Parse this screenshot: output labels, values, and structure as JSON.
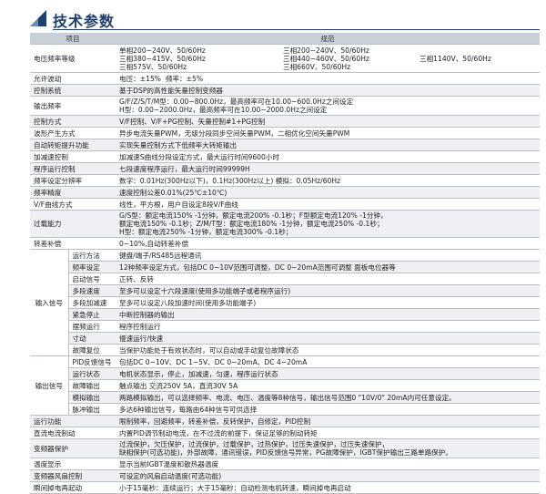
{
  "header": {
    "title": "技术参数"
  },
  "table": {
    "col_item": "项目",
    "col_spec": "规范",
    "voltage_label": "电压频率等级",
    "voltage_col1": [
      "单相200~240V、50/60Hz",
      "三相380~415V、50/60Hz",
      "三相575V、50/60Hz"
    ],
    "voltage_col2": [
      "三相200~240V、50/60Hz",
      "三相440~460V、50/60Hz",
      "三相660V、50/60Hz"
    ],
    "voltage_col3": "三相1140V、50/60Hz",
    "rows_a": [
      {
        "item": "允许波动",
        "spec": "电压：±15%  频率：±5%"
      },
      {
        "item": "控制系统",
        "spec": "基于DSP的高性能矢量控制变频器"
      },
      {
        "item": "输出频率",
        "spec": "G/F/Z/S/T/M型：0.00~800.0Hz，最高频率可在10.00~600.0Hz之间设定\nH型：0.00~2000.0Hz，最高频率可在10.00~2000.0Hz之间设定"
      },
      {
        "item": "控制方式",
        "spec": "V/F控制、V/F+PG控制、矢量控制#1+PG控制"
      },
      {
        "item": "波形产生方式",
        "spec": "异步电流矢量PWM，无级分段同步空间矢量PWM，二相优化空间矢量PWM"
      },
      {
        "item": "自动转矩提升功能",
        "spec": "实现矢量控制方式下低频率大转矩输出"
      },
      {
        "item": "加减速控制",
        "spec": "加减速S曲线分段设定方式，最大运行时间9600小时"
      },
      {
        "item": "程序运行控制",
        "spec": "七段速度程序运行，最大运行时间99999H"
      },
      {
        "item": "频率设定分辨率",
        "spec": "数字：0.01Hz(300Hz以下)，0.1Hz(300Hz以上) 模拟：0.05Hz/60Hz"
      },
      {
        "item": "频率精度",
        "spec": "速度控制公差0.01%(25℃±10℃)"
      },
      {
        "item": "V/F曲线方式",
        "spec": "线性，平方根，用户自设定8段V/F曲线"
      },
      {
        "item": "过载能力",
        "spec": "G/S型：额定电流150% -1分钟，额定电流200% -0.1秒；F型额定电流120% -1分钟，\n额定电流150% -0.1秒；Z/M/T型：额定电流180% -1分钟，额定电流250% -0.1秒；\nH型：额定电流250% -1分钟，额定电流300% -0.1秒；"
      },
      {
        "item": "转差补偿",
        "spec": "0~10%,自动转差补偿"
      }
    ],
    "input_group": "输入信号",
    "rows_input": [
      {
        "sub": "运行方法",
        "spec": "键盘/端子/RS485远程通讯"
      },
      {
        "sub": "频率设定",
        "spec": "12种频率设定方式，包括DC 0~10V范围可调整，DC 0~20mA范围可调整 面板电位器等"
      },
      {
        "sub": "启动信号",
        "spec": "正转、反转"
      },
      {
        "sub": "多段速度",
        "spec": "至多可以设定十六段速度(使用多功能端子或者程序运行)"
      },
      {
        "sub": "多段加减速",
        "spec": "至多可以设定八段加速时间(使用多功能端子)"
      },
      {
        "sub": "紧急停止",
        "spec": "中断控制器的输出"
      },
      {
        "sub": "摆频运行",
        "spec": "程序控制运行"
      },
      {
        "sub": "寸动",
        "spec": "慢速运行/快速"
      },
      {
        "sub": "故障复位",
        "spec": "当保护功能处于有效状态时，可以自动或手动复位故障状态"
      }
    ],
    "output_group": "输出信号",
    "rows_output": [
      {
        "sub": "PID反馈信号",
        "spec": "包括DC 0~10V、DC 1~5V、DC 0~20mA、DC 4~20mA"
      },
      {
        "sub": "运行状态",
        "spec": "电机状态显示，停止，加减速，匀速，程序运行状态"
      },
      {
        "sub": "故障输出",
        "spec": "触点输出 交流250V 5A，直流30V 5A"
      },
      {
        "sub": "模拟输出",
        "spec": "两路模拟输出，可以选择频率、电流、电压、温度等8种信号，输出信号范围0 \"10V/0\" 20mA内可任意设定。"
      },
      {
        "sub": "脉冲输出",
        "spec": "多达6种输出信号，每路由64种信号可供选择"
      }
    ],
    "rows_b": [
      {
        "item": "运行功能",
        "spec": "限制频率，回避频率，转差补偿，反转保护，自修定，PID控制"
      },
      {
        "item": "直流电流制动",
        "spec": "内置PID调节制动电流，在不过流的前提下，保证足够的制动转矩"
      },
      {
        "item": "变频器保护",
        "spec": "过流保护，欠压保护，过流保护，过载保护，过热保护，过压失速保护，过压失速保护，\n缺相保护(可选功能)，外部故障，通讯错误，PID反馈信号异常，PG故障保护，IGBT保护输出三路单路保护。"
      },
      {
        "item": "温度显示",
        "spec": "显示当前IGBT温度和散热器温度"
      },
      {
        "item": "变频器风扇控制",
        "spec": "可设定的风扇启动温度(可选功能)"
      },
      {
        "item": "瞬间掉电再起动",
        "spec": "小于15毫秒：连续运行；大于15毫秒：自动检测电机转速，瞬间掉电再启动"
      }
    ]
  }
}
